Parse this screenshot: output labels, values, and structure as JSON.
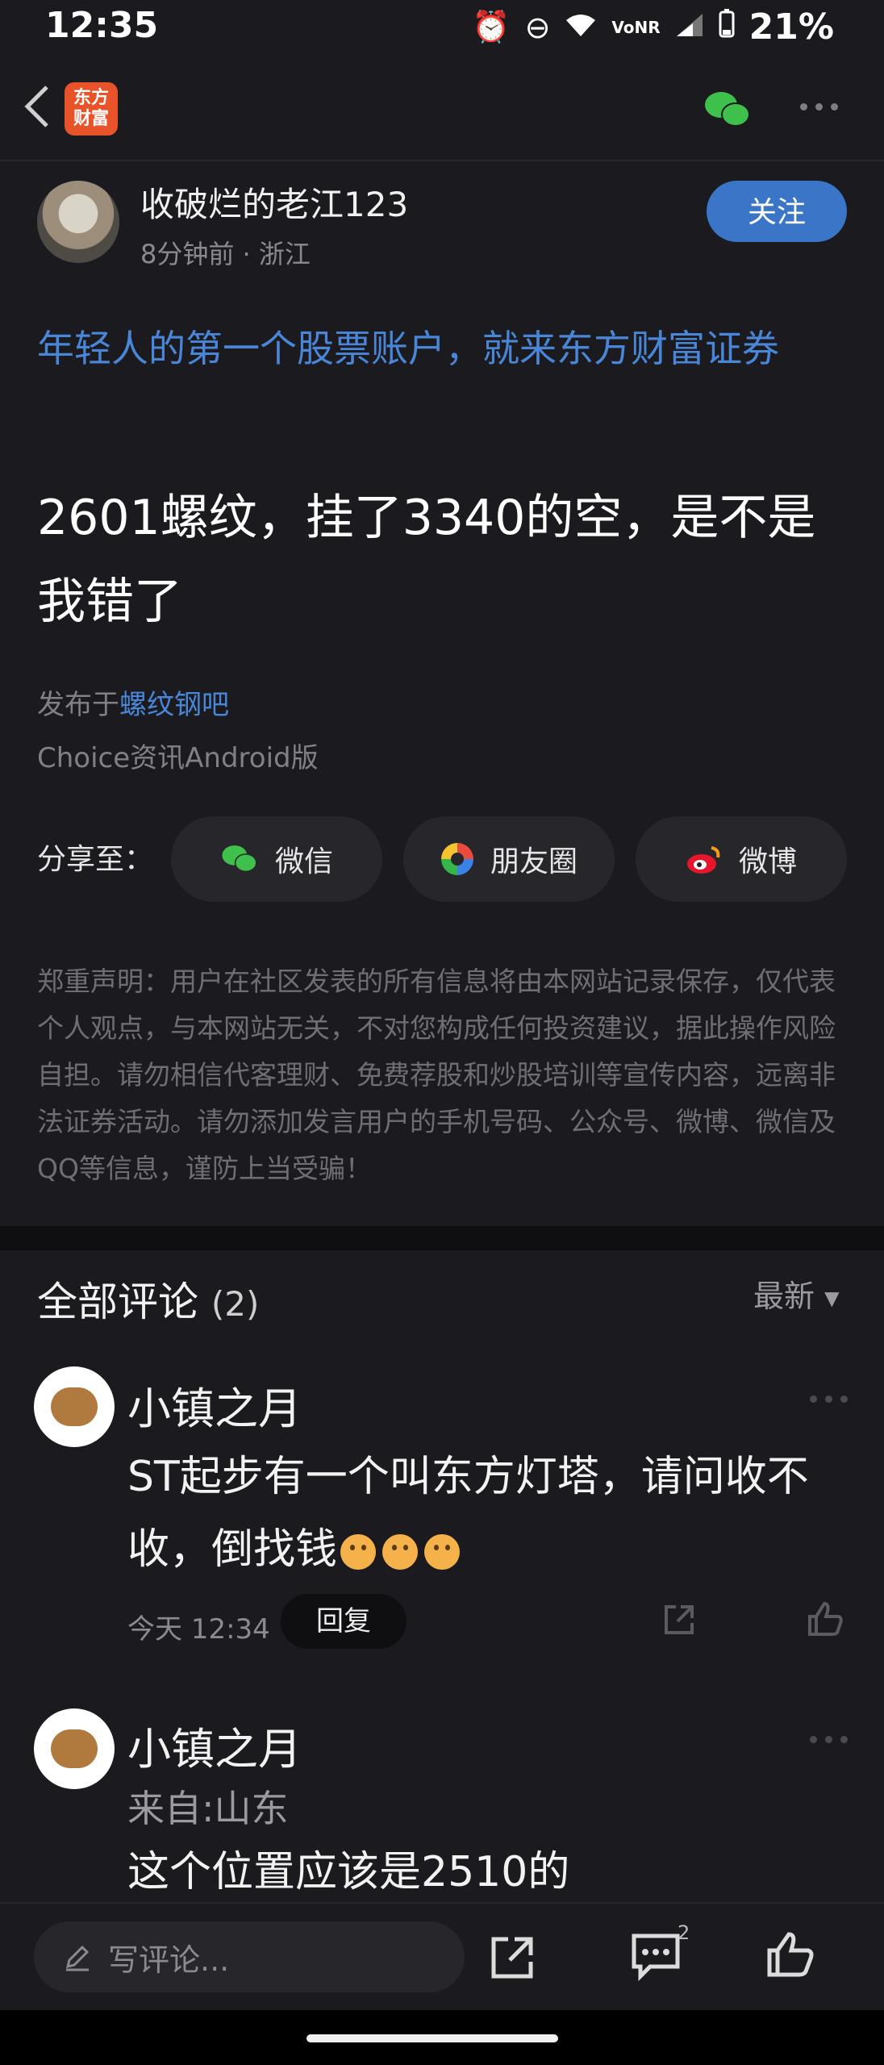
{
  "status_bar": {
    "time": "12:35",
    "network": "VoNR",
    "battery": "21%"
  },
  "top_nav": {
    "logo_text": "东方\n财富"
  },
  "author": {
    "name": "收破烂的老江123",
    "meta": "8分钟前 · 浙江",
    "follow_label": "关注"
  },
  "post": {
    "ad_link": "年轻人的第一个股票账户，就来东方财富证券",
    "title": "2601螺纹，挂了3340的空，是不是我错了",
    "published_prefix": "发布于",
    "published_board": "螺纹钢吧",
    "source": "Choice资讯Android版"
  },
  "share": {
    "label": "分享至：",
    "options": [
      "微信",
      "朋友圈",
      "微博"
    ]
  },
  "disclaimer": "郑重声明：用户在社区发表的所有信息将由本网站记录保存，仅代表个人观点，与本网站无关，不对您构成任何投资建议，据此操作风险自担。请勿相信代客理财、免费荐股和炒股培训等宣传内容，远离非法证券活动。请勿添加发言用户的手机号码、公众号、微博、微信及QQ等信息，谨防上当受骗！",
  "comments_header": {
    "title": "全部评论",
    "count": "(2)",
    "sort": "最新"
  },
  "comments": [
    {
      "name": "小镇之月",
      "body": "ST起步有一个叫东方灯塔，请问收不收，倒找钱",
      "time": "今天 12:34",
      "reply_label": "回复"
    },
    {
      "name": "小镇之月",
      "from": "来自:山东",
      "body": "这个位置应该是2510的"
    }
  ],
  "bottom_bar": {
    "input_placeholder": "写评论...",
    "comment_count": "2"
  },
  "colors": {
    "accent": "#3a75c8",
    "link": "#4a86d8",
    "background": "#1b1b1f"
  }
}
